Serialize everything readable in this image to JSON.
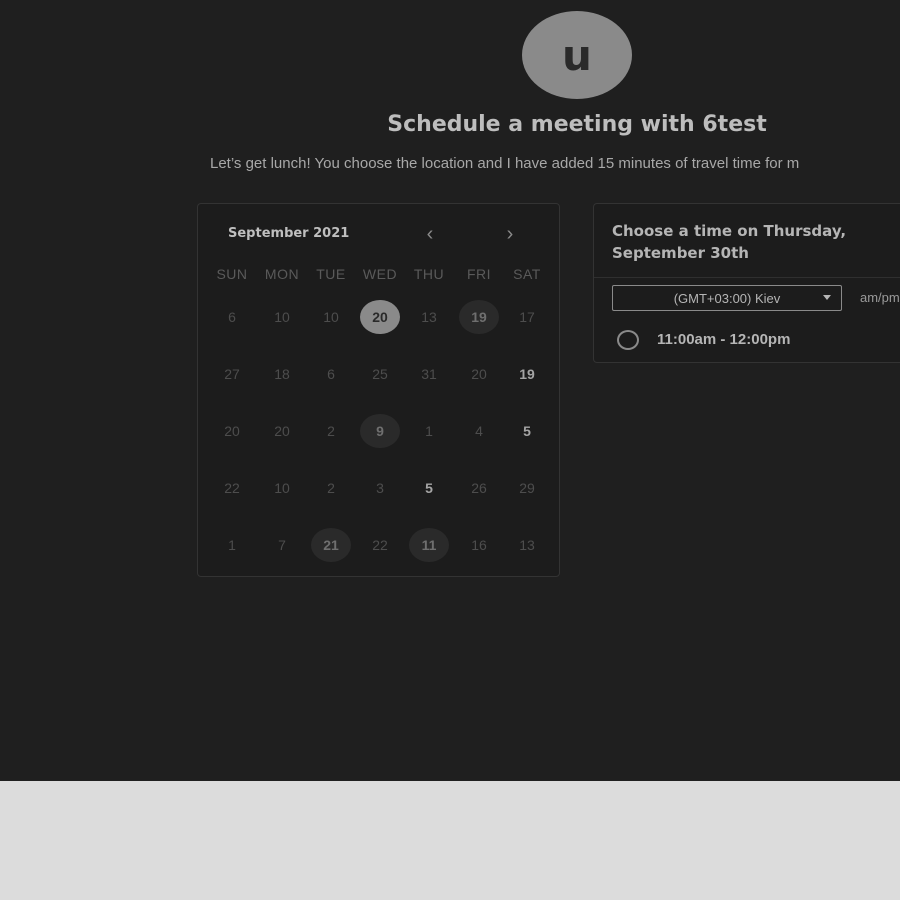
{
  "avatar": {
    "initial": "u"
  },
  "header": {
    "title": "Schedule a meeting with 6test",
    "description": "Let’s get lunch! You choose the location and I have added 15 minutes of travel time for m"
  },
  "calendar": {
    "month_label": "September 2021",
    "prev_icon": "‹",
    "next_icon": "›",
    "weekdays": [
      "SUN",
      "MON",
      "TUE",
      "WED",
      "THU",
      "FRI",
      "SAT"
    ],
    "weeks": [
      [
        {
          "label": "6",
          "state": "muted"
        },
        {
          "label": "10",
          "state": "muted"
        },
        {
          "label": "10",
          "state": "muted"
        },
        {
          "label": "20",
          "state": "selected"
        },
        {
          "label": "13",
          "state": "muted"
        },
        {
          "label": "19",
          "state": "available"
        },
        {
          "label": "17",
          "state": "muted"
        }
      ],
      [
        {
          "label": "27",
          "state": "muted"
        },
        {
          "label": "18",
          "state": "muted"
        },
        {
          "label": "6",
          "state": "muted"
        },
        {
          "label": "25",
          "state": "muted"
        },
        {
          "label": "31",
          "state": "muted"
        },
        {
          "label": "20",
          "state": "muted"
        },
        {
          "label": "19",
          "state": "bold"
        }
      ],
      [
        {
          "label": "20",
          "state": "muted"
        },
        {
          "label": "20",
          "state": "muted"
        },
        {
          "label": "2",
          "state": "muted"
        },
        {
          "label": "9",
          "state": "available"
        },
        {
          "label": "1",
          "state": "muted"
        },
        {
          "label": "4",
          "state": "muted"
        },
        {
          "label": "5",
          "state": "bold"
        }
      ],
      [
        {
          "label": "22",
          "state": "muted"
        },
        {
          "label": "10",
          "state": "muted"
        },
        {
          "label": "2",
          "state": "muted"
        },
        {
          "label": "3",
          "state": "muted"
        },
        {
          "label": "5",
          "state": "bold"
        },
        {
          "label": "26",
          "state": "muted"
        },
        {
          "label": "29",
          "state": "muted"
        }
      ],
      [
        {
          "label": "1",
          "state": "muted"
        },
        {
          "label": "7",
          "state": "muted"
        },
        {
          "label": "21",
          "state": "available"
        },
        {
          "label": "22",
          "state": "muted"
        },
        {
          "label": "11",
          "state": "available"
        },
        {
          "label": "16",
          "state": "muted"
        },
        {
          "label": "13",
          "state": "muted"
        }
      ]
    ]
  },
  "time_panel": {
    "title": "Choose a time on Thursday, September 30th",
    "timezone": "(GMT+03:00) Kiev",
    "format_label": "am/pm",
    "slots": [
      {
        "label": "11:00am - 12:00pm"
      }
    ]
  }
}
